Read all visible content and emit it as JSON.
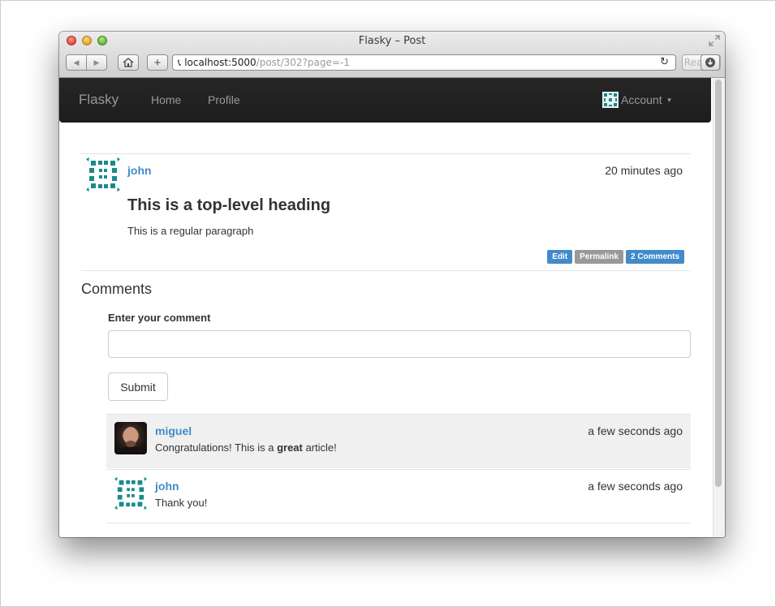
{
  "window": {
    "title": "Flasky – Post",
    "url_host": "localhost:5000",
    "url_path": "/post/302?page=-1",
    "reader_label": "Reader"
  },
  "navbar": {
    "brand": "Flasky",
    "links": [
      {
        "label": "Home"
      },
      {
        "label": "Profile"
      }
    ],
    "account_label": "Account"
  },
  "post": {
    "author": "john",
    "timestamp": "20 minutes ago",
    "heading": "This is a top-level heading",
    "paragraph": "This is a regular paragraph",
    "actions": {
      "edit": "Edit",
      "permalink": "Permalink",
      "comments": "2 Comments"
    }
  },
  "comments_section": {
    "title": "Comments",
    "form_label": "Enter your comment",
    "input_value": "",
    "submit_label": "Submit",
    "items": [
      {
        "author": "miguel",
        "timestamp": "a few seconds ago",
        "body_before": "Congratulations! This is a ",
        "body_bold": "great",
        "body_after": " article!"
      },
      {
        "author": "john",
        "timestamp": "a few seconds ago",
        "body": "Thank you!"
      }
    ]
  },
  "colors": {
    "link": "#428bca",
    "navbar_bg": "#222222",
    "label_primary": "#428bca",
    "label_default": "#999999",
    "identicon_teal": "#1a8a8c"
  },
  "icons": [
    "fullscreen-icon",
    "back-icon",
    "forward-icon",
    "home-icon",
    "add-icon",
    "phone-icon",
    "reload-icon",
    "download-icon",
    "identicon-avatar",
    "caret-down-icon"
  ]
}
